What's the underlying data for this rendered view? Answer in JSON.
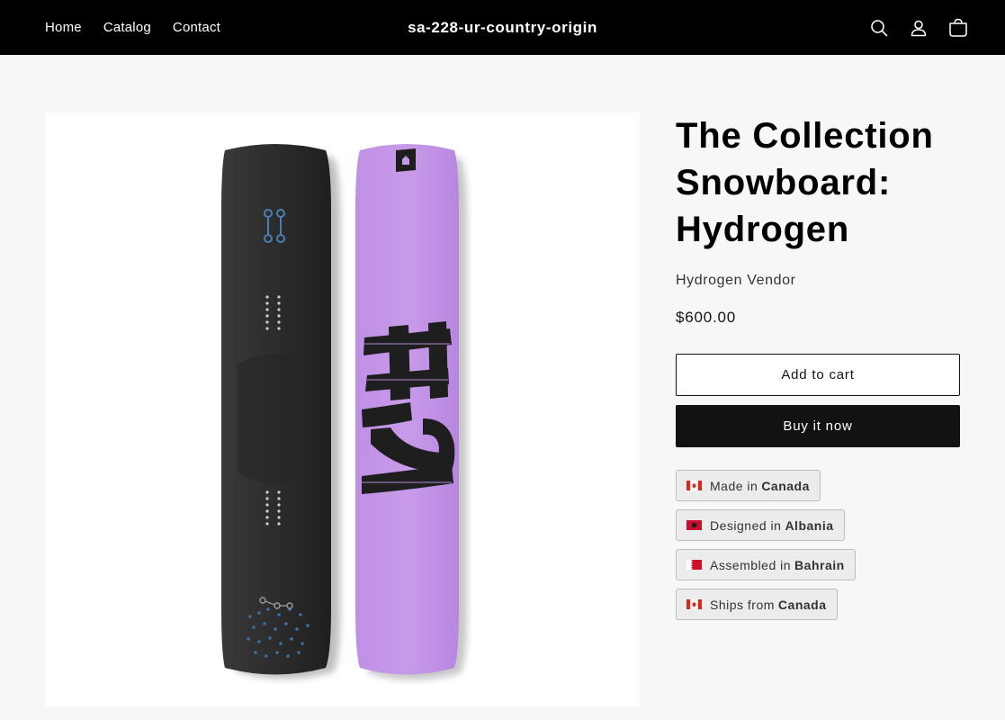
{
  "header": {
    "nav": [
      "Home",
      "Catalog",
      "Contact"
    ],
    "store_name": "sa-228-ur-country-origin",
    "icons": [
      "search-icon",
      "account-icon",
      "cart-icon"
    ]
  },
  "product": {
    "title": "The Collection Snowboard: Hydrogen",
    "vendor": "Hydrogen Vendor",
    "price": "$600.00",
    "add_to_cart": "Add to cart",
    "buy_now": "Buy it now",
    "image": {
      "graphic_text": "H2",
      "colors": {
        "black_board": "#2a2a2a",
        "purple_board": "#c597e8",
        "accent_blue": "#3d6fa0"
      }
    }
  },
  "origins": [
    {
      "label": "Made in",
      "country": "Canada",
      "flag": "canada-flag-icon"
    },
    {
      "label": "Designed in",
      "country": "Albania",
      "flag": "albania-flag-icon"
    },
    {
      "label": "Assembled in",
      "country": "Bahrain",
      "flag": "bahrain-flag-icon"
    },
    {
      "label": "Ships from",
      "country": "Canada",
      "flag": "canada-flag-icon"
    }
  ],
  "colors": {
    "header_bg": "#000000",
    "page_bg": "#f7f7f5",
    "button_dark": "#121212",
    "badge_bg": "#ececec"
  }
}
